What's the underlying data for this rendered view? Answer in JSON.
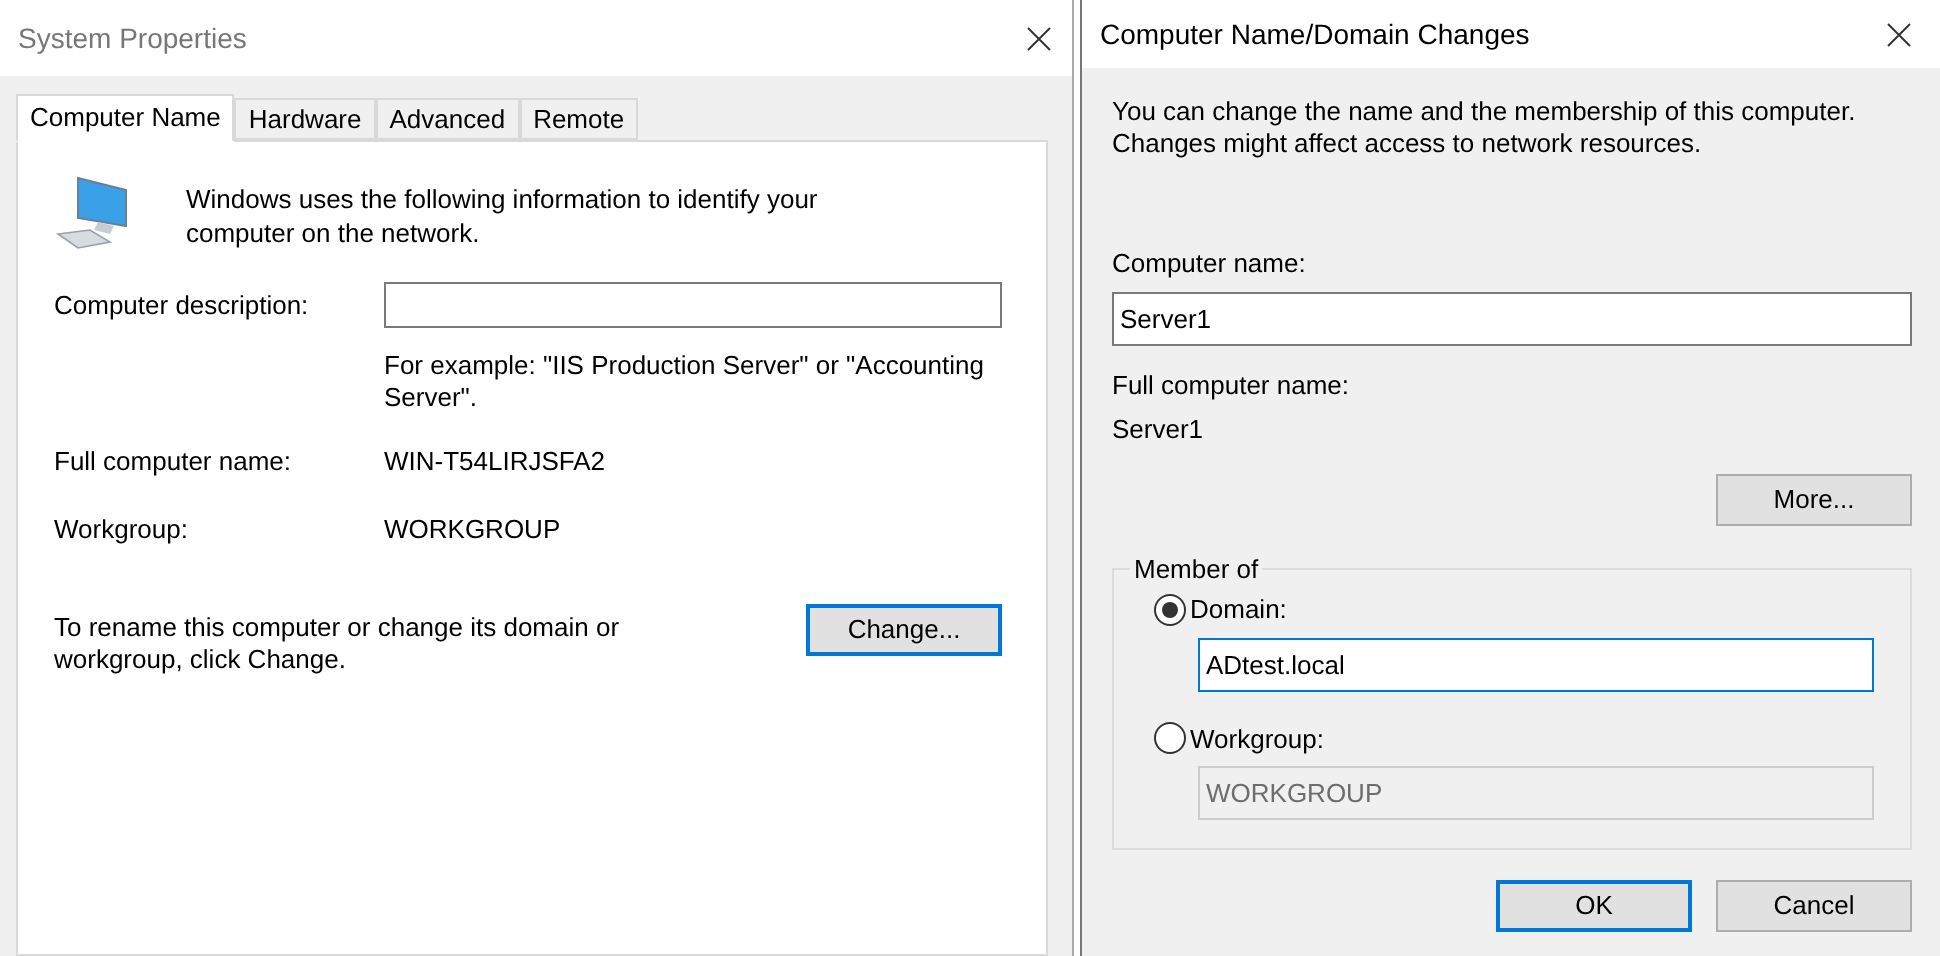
{
  "system_properties": {
    "title": "System Properties",
    "tabs": [
      {
        "label": "Computer Name",
        "selected": true
      },
      {
        "label": "Hardware",
        "selected": false
      },
      {
        "label": "Advanced",
        "selected": false
      },
      {
        "label": "Remote",
        "selected": false
      }
    ],
    "intro": "Windows uses the following information to identify your computer on the network.",
    "description_label": "Computer description:",
    "description_hint": "For example: \"IIS Production Server\" or \"Accounting Server\".",
    "rows": [
      {
        "label": "Full computer name:",
        "value": "WIN-T54LIRJSFA2"
      },
      {
        "label": "Workgroup:",
        "value": "WORKGROUP"
      }
    ],
    "rename_text": "To rename this computer or change its domain or workgroup, click Change.",
    "change_button": {
      "label": "Change...",
      "focused": true
    }
  },
  "domain_changes": {
    "title": "Computer Name/Domain Changes",
    "intro": "You can change the name and the membership of this computer. Changes might affect access to network resources.",
    "computer_name_label": "Computer name:",
    "computer_name_value": "Server1",
    "full_name_label": "Full computer name:",
    "full_name_value": "Server1",
    "more_button": "More...",
    "member_of": {
      "legend": "Member of",
      "options": [
        {
          "label": "Domain:",
          "selected": true,
          "value": "ADtest.local",
          "disabled": false,
          "focused": true
        },
        {
          "label": "Workgroup:",
          "selected": false,
          "value": "WORKGROUP",
          "disabled": true,
          "focused": false
        }
      ]
    },
    "buttons": [
      {
        "label": "OK",
        "default": true
      },
      {
        "label": "Cancel",
        "default": false
      }
    ]
  }
}
